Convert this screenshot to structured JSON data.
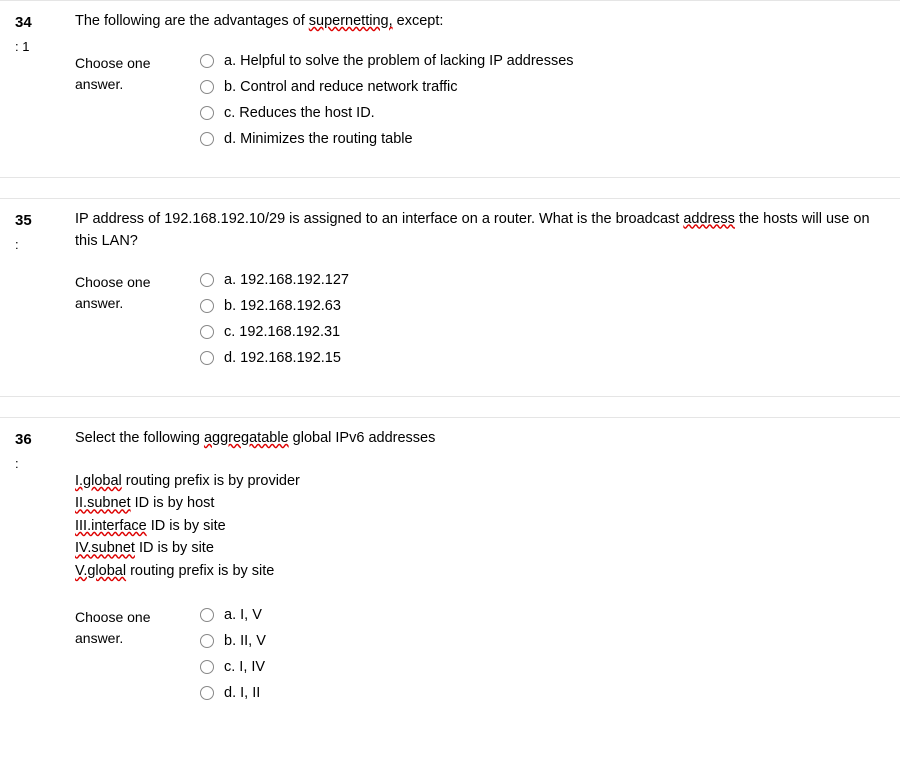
{
  "questions": [
    {
      "number": "34",
      "sub": ": 1",
      "text_pre": "The following are the advantages of ",
      "text_squiggle": "supernetting,",
      "text_post": " except:",
      "choose": "Choose one answer.",
      "options": [
        "a. Helpful to solve the problem of lacking IP addresses",
        "b. Control and reduce network traffic",
        "c. Reduces the host ID.",
        "d. Minimizes the routing table"
      ]
    },
    {
      "number": "35",
      "sub": ":",
      "text_pre": "IP address of 192.168.192.10/29 is assigned to an interface on a router. What is the broadcast ",
      "text_squiggle": "address",
      "text_post": " the hosts will use on this LAN?",
      "choose": "Choose one answer.",
      "options": [
        "a. 192.168.192.127",
        "b. 192.168.192.63",
        "c. 192.168.192.31",
        "d. 192.168.192.15"
      ]
    },
    {
      "number": "36",
      "sub": ":",
      "text_pre": "Select the following ",
      "text_squiggle": "aggregatable",
      "text_post": " global IPv6  addresses",
      "statements": [
        {
          "sq": "I.global",
          "rest": " routing prefix is by provider"
        },
        {
          "sq": "II.subnet",
          "rest": " ID is by host"
        },
        {
          "sq": "III.interface",
          "rest": " ID is by site"
        },
        {
          "sq": "IV.subnet",
          "rest": " ID is by site"
        },
        {
          "sq": "V.global",
          "rest": " routing prefix is by site"
        }
      ],
      "choose": "Choose one answer.",
      "options": [
        "a. I, V",
        "b. II, V",
        "c. I, IV",
        "d. I, II"
      ]
    }
  ]
}
